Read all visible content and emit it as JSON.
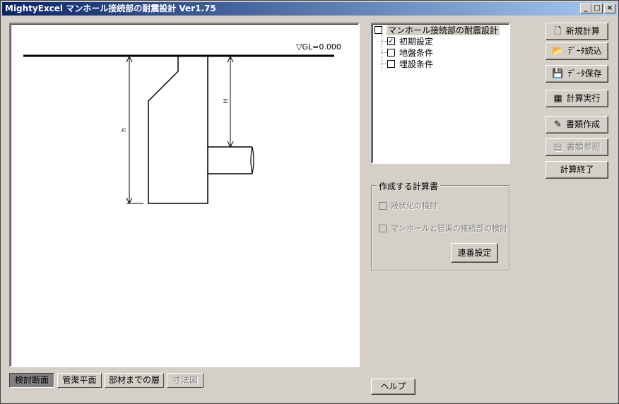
{
  "window": {
    "title": "MightyExcel マンホール接続部の耐震設計  Ver1.75",
    "controls": [
      "minimize-icon",
      "maximize-icon",
      "close-icon"
    ]
  },
  "drawing": {
    "gl_label": "▽GL=0.000",
    "dim_h_small": "H",
    "dim_h_large": "h"
  },
  "tree": {
    "root": {
      "label": "マンホール接続部の耐震設計",
      "checked": false
    },
    "children": [
      {
        "label": "初期設定",
        "checked": true
      },
      {
        "label": "地盤条件",
        "checked": false
      },
      {
        "label": "埋設条件",
        "checked": false
      }
    ]
  },
  "right_buttons": {
    "new_calc": "新規計算",
    "data_read": "ﾃﾞｰﾀ読込",
    "data_save": "ﾃﾞｰﾀ保存",
    "calc_run": "計算実行",
    "doc_create": "書類作成",
    "doc_view": "書類参照",
    "calc_end": "計算終了"
  },
  "report_group": {
    "title": "作成する計算書",
    "option1": "液状化の検討",
    "option2": "マンホールと管渠の接続部の検討",
    "serial_button": "連番設定"
  },
  "help_button": "ヘルプ",
  "bottom_tabs": {
    "tab1": "検討断面",
    "tab2": "管渠平面",
    "tab3": "部材までの層",
    "tab4": "寸法図"
  }
}
